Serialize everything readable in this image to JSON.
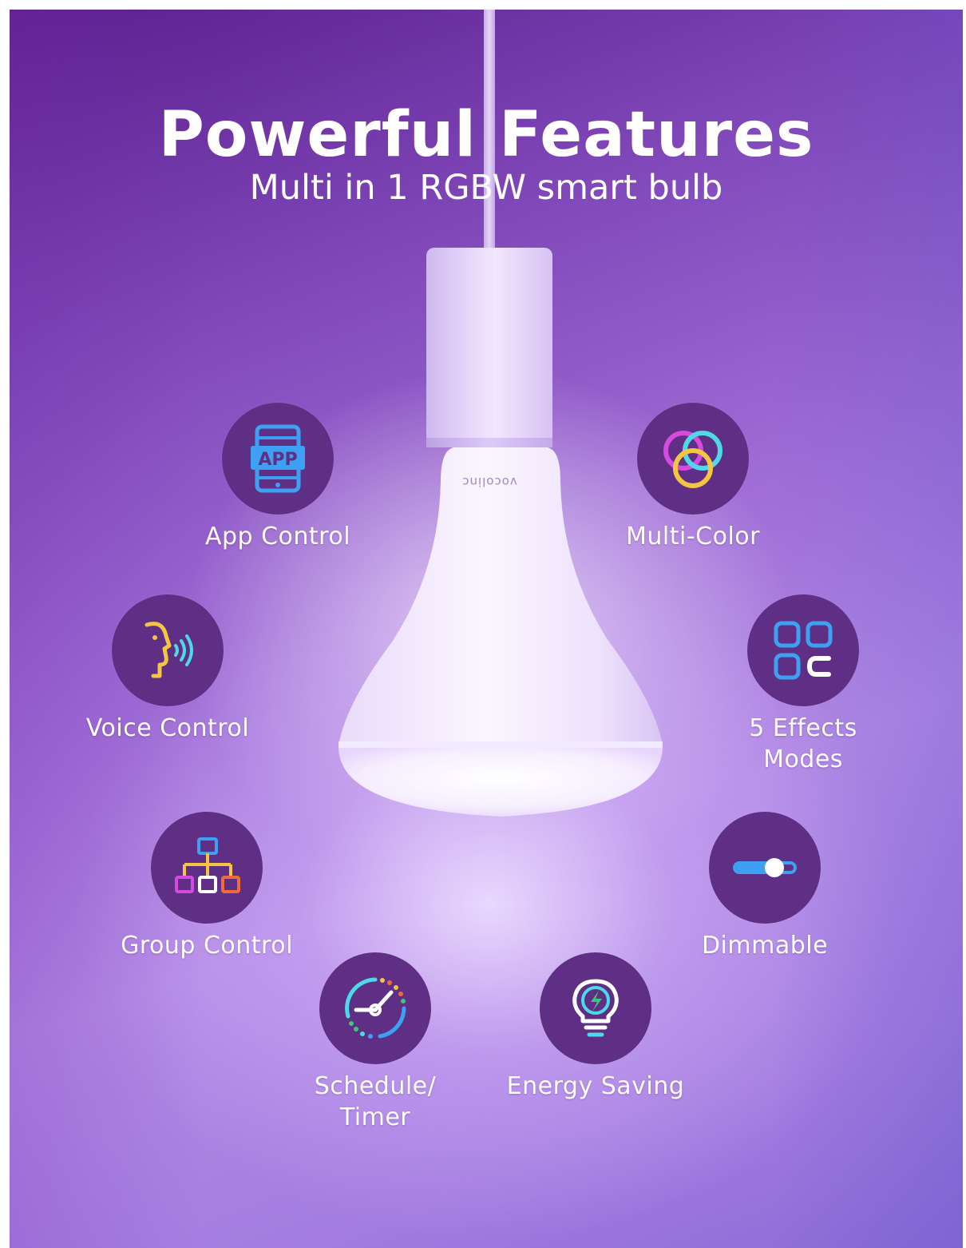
{
  "header": {
    "title": "Powerful Features",
    "subtitle": "Multi in 1 RGBW smart bulb"
  },
  "product": {
    "brand": "vocolinc"
  },
  "features": [
    {
      "label": "App Control",
      "icon": "app-tablet-icon",
      "icon_text": "APP"
    },
    {
      "label": "Multi-Color",
      "icon": "color-rings-icon"
    },
    {
      "label": "Voice Control",
      "icon": "voice-face-icon"
    },
    {
      "label": "5 Effects Modes",
      "icon": "effects-grid-icon"
    },
    {
      "label": "Group Control",
      "icon": "group-tree-icon"
    },
    {
      "label": "Dimmable",
      "icon": "dimmer-slider-icon"
    },
    {
      "label": "Schedule/ Timer",
      "icon": "timer-clock-icon"
    },
    {
      "label": "Energy Saving",
      "icon": "energy-bulb-icon"
    }
  ],
  "colors": {
    "circle": "#5e2f85",
    "icon_blue": "#3ea0f2",
    "icon_cyan": "#4fd9e6",
    "icon_yellow": "#f4c542",
    "icon_magenta": "#d64adf",
    "icon_orange": "#f06a3a",
    "icon_green": "#3cc87a"
  }
}
